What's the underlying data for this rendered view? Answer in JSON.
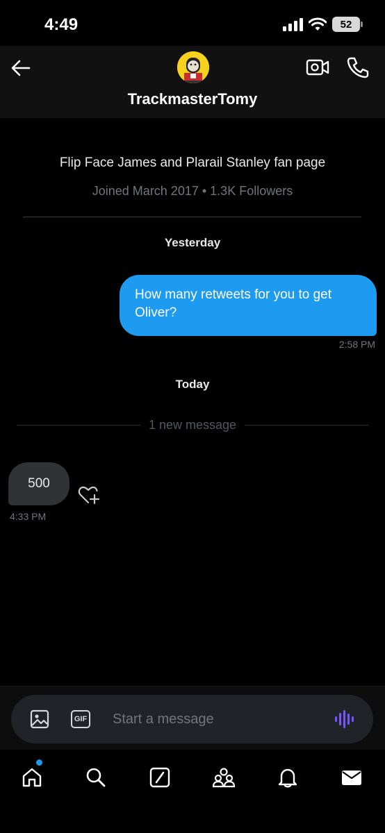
{
  "status_bar": {
    "time": "4:49",
    "battery": "52"
  },
  "header": {
    "title": "TrackmasterTomy",
    "icons": {
      "back": "arrow-left-icon",
      "video": "video-camera-icon",
      "call": "phone-icon"
    }
  },
  "profile": {
    "bio": "Flip Face James and Plarail Stanley fan page",
    "meta": "Joined March 2017 • 1.3K Followers"
  },
  "conversation": {
    "day_1": "Yesterday",
    "outgoing_message": {
      "text": "How many retweets for you to get Oliver?",
      "time": "2:58 PM"
    },
    "day_2": "Today",
    "new_message_divider": "1 new message",
    "incoming_message": {
      "text": "500",
      "time": "4:33 PM"
    }
  },
  "composer": {
    "placeholder": "Start a message",
    "gif_label": "GIF"
  },
  "tabbar": {
    "items": [
      "home-icon",
      "search-icon",
      "grok-icon",
      "communities-icon",
      "notifications-icon",
      "messages-icon"
    ]
  },
  "colors": {
    "accent": "#1d9bf0",
    "voice": "#7856ff",
    "bubble_incoming": "#2f3336",
    "muted_text": "#71767b"
  }
}
